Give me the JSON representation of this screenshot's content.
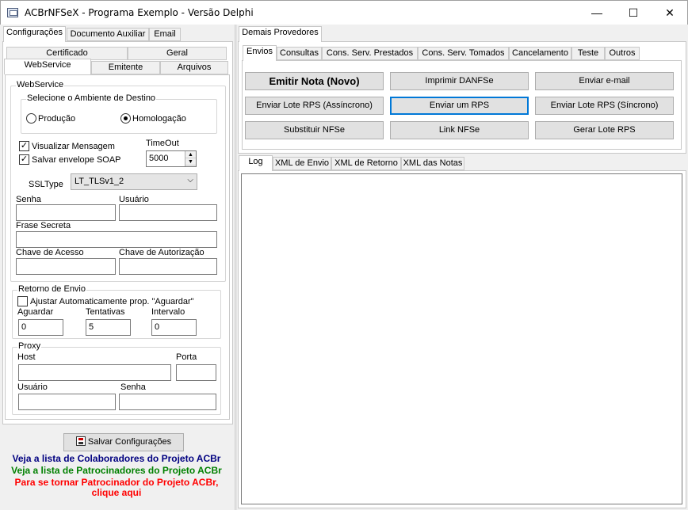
{
  "window": {
    "title": "ACBrNFSeX - Programa Exemplo - Versão Delphi",
    "minimize": "—",
    "maximize": "☐",
    "close": "✕"
  },
  "left": {
    "tabs_row1": [
      "Configurações",
      "Documento Auxiliar",
      "Email"
    ],
    "tabs_row2": [
      "Certificado",
      "Geral"
    ],
    "tabs_row3": [
      "WebService",
      "Emitente",
      "Arquivos"
    ],
    "webservice": {
      "group_label": "WebService",
      "ambiente_label": "Selecione o Ambiente de Destino",
      "producao": "Produção",
      "homologacao": "Homologação",
      "visualizar": "Visualizar Mensagem",
      "salvar_envelope": "Salvar envelope SOAP",
      "timeout_label": "TimeOut",
      "timeout_value": "5000",
      "ssltype_label": "SSLType",
      "ssltype_value": "LT_TLSv1_2",
      "senha_label": "Senha",
      "usuario_label": "Usuário",
      "frase_label": "Frase Secreta",
      "chave_acesso_label": "Chave de Acesso",
      "chave_autorizacao_label": "Chave de Autorização"
    },
    "retorno": {
      "group_label": "Retorno de Envio",
      "ajustar": "Ajustar Automaticamente prop. \"Aguardar\"",
      "aguardar_label": "Aguardar",
      "aguardar_value": "0",
      "tentativas_label": "Tentativas",
      "tentativas_value": "5",
      "intervalo_label": "Intervalo",
      "intervalo_value": "0"
    },
    "proxy": {
      "group_label": "Proxy",
      "host_label": "Host",
      "porta_label": "Porta",
      "usuario_label": "Usuário",
      "senha_label": "Senha"
    },
    "save_button": "Salvar Configurações",
    "links": {
      "colaboradores": "Veja a lista de Colaboradores do Projeto ACBr",
      "patrocinadores": "Veja a lista de Patrocinadores do Projeto ACBr",
      "tornar_1": "Para se tornar Patrocinador do Projeto ACBr,",
      "tornar_2": "clique aqui"
    }
  },
  "right": {
    "outer_tab": "Demais Provedores",
    "tabs": [
      "Envios",
      "Consultas",
      "Cons. Serv. Prestados",
      "Cons. Serv. Tomados",
      "Cancelamento",
      "Teste",
      "Outros"
    ],
    "buttons": {
      "emitir": "Emitir Nota (Novo)",
      "imprimir": "Imprimir DANFSe",
      "email": "Enviar e-mail",
      "lote_assinc": "Enviar Lote RPS (Assíncrono)",
      "enviar_rps": "Enviar um RPS",
      "lote_sinc": "Enviar Lote RPS (Síncrono)",
      "substituir": "Substituir NFSe",
      "link": "Link NFSe",
      "gerar": "Gerar Lote RPS"
    },
    "log_tabs": [
      "Log",
      "XML de Envio",
      "XML de Retorno",
      "XML das Notas"
    ]
  },
  "colors": {
    "link_blue": "#000080",
    "link_green": "#008000",
    "link_red": "#ff0000",
    "focus_blue": "#0078d7"
  }
}
